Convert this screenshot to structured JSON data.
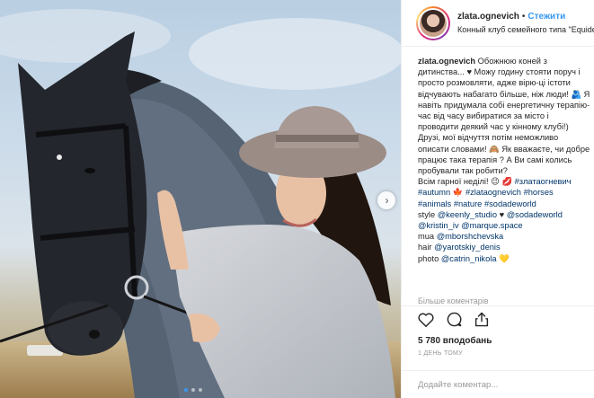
{
  "post": {
    "username": "zlata.ognevich",
    "follow_label": "Стежити",
    "header_separator": "•",
    "location": "Конный клуб семейного типа \"Equides",
    "caption_lines": [
      "Обожнюю коней з дитинства... ♥ Можу годину стояти поруч і просто розмовляти, адже вірю-ці істоти відчувають набагато більше, ніж люди!",
      "Я навіть придумала собі енергетичну терапію- час від часу вибиратися за місто і проводити деякий час у кінному клубі!) Друзі, мої відчуття потім неможливо описати словами!",
      "Як вважаєте, чи добре працює така терапія ? А Ви самі колись пробували так робити?",
      "Всім гарної неділі!"
    ],
    "caption_emojis": [
      "🫂",
      "🙈",
      "😉",
      "💋"
    ],
    "hashtags_line1": [
      "#златаогневич"
    ],
    "hashtags_line2": [
      "#autumn",
      "🍁",
      "#zlataognevich",
      "#horses"
    ],
    "hashtags_line3": [
      "#animals",
      "#nature",
      "#sodadeworld"
    ],
    "credits": [
      {
        "label": "style",
        "mentions": [
          "@keenly_studio",
          "♥",
          "@sodadeworld"
        ]
      },
      {
        "label": "",
        "mentions": [
          "@kristin_iv",
          "@marque.space"
        ]
      },
      {
        "label": "mua",
        "mentions": [
          "@mborshchevska"
        ]
      },
      {
        "label": "hair",
        "mentions": [
          "@yarotskiy_denis"
        ]
      },
      {
        "label": "photo",
        "mentions": [
          "@catrin_nikola",
          "💛"
        ]
      }
    ],
    "more_comments_label": "Більше коментарів",
    "likes": "5 780 вподобань",
    "time_ago": "1 ДЕНЬ ТОМУ",
    "comment_placeholder": "Додайте коментар..."
  },
  "carousel": {
    "next_icon": "chevron-right-icon",
    "dots_total": 3,
    "active_dot": 1
  },
  "colors": {
    "accent": "#3897f0",
    "hashtag": "#003569",
    "muted": "#999999",
    "border": "#efefef"
  }
}
